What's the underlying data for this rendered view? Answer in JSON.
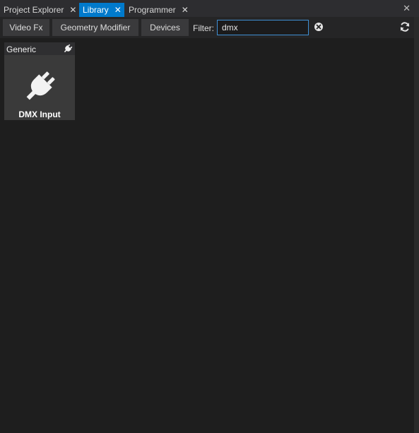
{
  "tabs": [
    {
      "label": "Project Explorer",
      "close": "✕",
      "active": false
    },
    {
      "label": "Library",
      "close": "✕",
      "active": true
    },
    {
      "label": "Programmer",
      "close": "✕",
      "active": false
    }
  ],
  "window": {
    "close": "✕"
  },
  "toolbar": {
    "buttons": [
      {
        "label": "Video Fx"
      },
      {
        "label": "Geometry Modifier"
      },
      {
        "label": "Devices"
      }
    ],
    "filter_label": "Filter:",
    "filter_value": "dmx",
    "clear_icon": "clear-circle-icon",
    "refresh_icon": "refresh-icon"
  },
  "library": {
    "items": [
      {
        "category": "Generic",
        "title": "DMX Input",
        "icon": "plug-icon"
      }
    ]
  },
  "colors": {
    "accent": "#007acc",
    "background": "#1e1e1e",
    "tabstrip": "#2d2d30",
    "card": "#3a3a3a"
  }
}
